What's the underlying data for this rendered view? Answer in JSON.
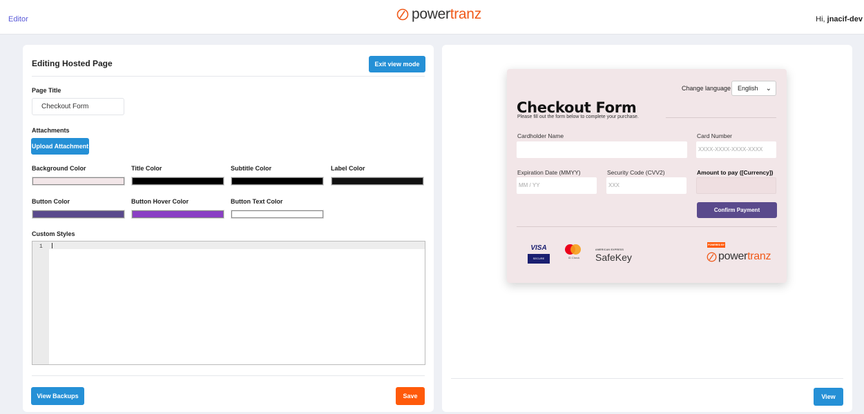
{
  "topbar": {
    "editor_link": "Editor",
    "brand": {
      "part1": "power",
      "part2": "tranz"
    },
    "greeting": "Hi, ",
    "username": "jnacif-dev"
  },
  "editor_panel": {
    "title": "Editing Hosted Page",
    "exit_button": "Exit view mode",
    "page_title_label": "Page Title",
    "page_title_value": "Checkout Form",
    "attachments_label": "Attachments",
    "upload_button": "Upload Attachment",
    "colors": [
      {
        "label": "Background Color",
        "value": "#f2e6e8"
      },
      {
        "label": "Title Color",
        "value": "#000000"
      },
      {
        "label": "Subtitle Color",
        "value": "#000000"
      },
      {
        "label": "Label Color",
        "value": "#111111"
      },
      {
        "label": "Button Color",
        "value": "#5a4a8c"
      },
      {
        "label": "Button Hover Color",
        "value": "#8a3fc4"
      },
      {
        "label": "Button Text Color",
        "value": "#ffffff"
      }
    ],
    "custom_styles_label": "Custom Styles",
    "code_line_number": "1",
    "view_backups_button": "View Backups",
    "save_button": "Save"
  },
  "preview_panel": {
    "view_button": "View",
    "checkout": {
      "change_language_label": "Change language",
      "language_value": "English",
      "title": "Checkout Form",
      "subtitle": "Please fill out the form below to complete your purchase.",
      "cardholder_label": "Cardholder Name",
      "card_number_label": "Card Number",
      "card_number_placeholder": "XXXX-XXXX-XXXX-XXXX",
      "expiration_label": "Expiration Date (MMYY)",
      "expiration_placeholder": "MM / YY",
      "security_label": "Security Code (CVV2)",
      "security_placeholder": "XXX",
      "amount_label": "Amount to pay ([Currency])",
      "confirm_button": "Confirm Payment",
      "visa_top": "VISA",
      "visa_bottom": "SECURE",
      "mastercard_text": "ID Check",
      "amex_top": "AMERICAN EXPRESS",
      "amex_bottom": "SafeKey",
      "powered_by": "POWERED BY"
    }
  },
  "accent_colors": {
    "blue_button": "#2590d6",
    "orange_button": "#ff5a0a",
    "brand_orange": "#f05a1a"
  }
}
